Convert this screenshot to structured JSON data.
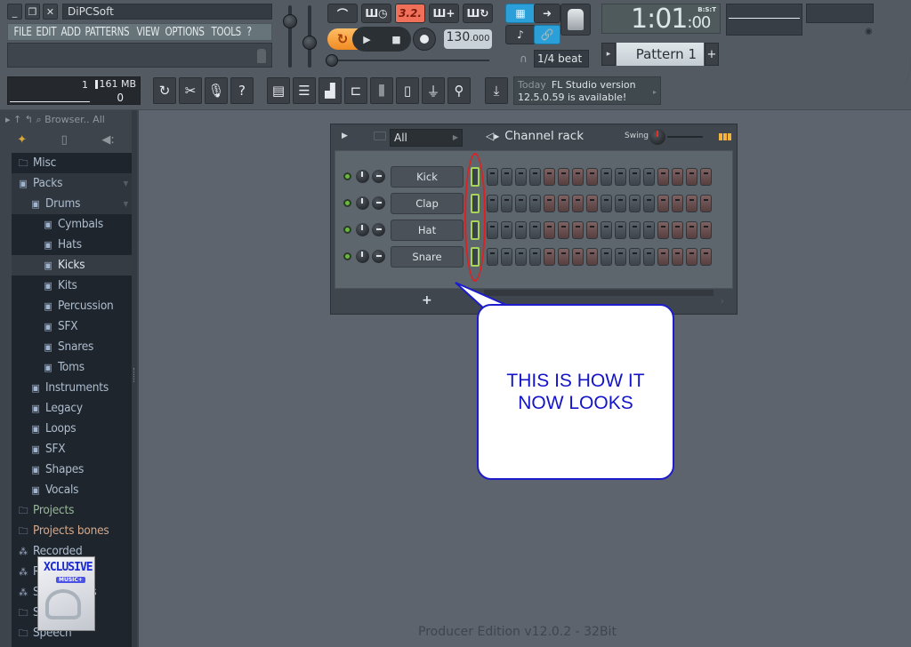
{
  "window": {
    "title": "DiPCSoft",
    "buttons": [
      "minimize",
      "restore",
      "close"
    ],
    "btn_glyphs": [
      "_",
      "❐",
      "✕"
    ]
  },
  "menu": [
    "FILE",
    "EDIT",
    "ADD",
    "PATTERNS",
    "VIEW",
    "OPTIONS",
    "TOOLS",
    "?"
  ],
  "transport": {
    "pattern_song_glyphs": [
      "⌒",
      "Ш◷",
      "3.2.",
      "Ш+",
      "Ш↻"
    ],
    "pattern_song_names": [
      "metronome-button",
      "wait-record-button",
      "countdown-button",
      "step-edit-button",
      "loop-record-button"
    ],
    "loop_glyph": "↻",
    "play_glyph": "▶",
    "stop_glyph": "■",
    "tempo_int": "130",
    "tempo_dec": ".000",
    "snap_label": "1/4 beat",
    "snap_arrow": "▸",
    "magnet_glyph": "∩"
  },
  "view_toggles": {
    "glyphs": [
      "▦",
      "➜",
      "♪",
      "🔗"
    ]
  },
  "time": {
    "main": "1:01",
    "sub": ":00",
    "label": "B:S:T"
  },
  "pattern": {
    "name": "Pattern 1",
    "prev_glyph": "▸",
    "add_glyph": "+"
  },
  "monitor": {
    "cpu": "1",
    "memory": "161 MB",
    "polyphony": "0"
  },
  "tool_buttons": [
    {
      "name": "undo-button",
      "glyph": "↻"
    },
    {
      "name": "cut-button",
      "glyph": "✂"
    },
    {
      "name": "record-audio-button",
      "glyph": "🎙"
    },
    {
      "name": "help-button",
      "glyph": "?"
    }
  ],
  "window_buttons": [
    {
      "name": "playlist-button",
      "glyph": "▤"
    },
    {
      "name": "channel-rack-button",
      "glyph": "☰"
    },
    {
      "name": "piano-roll-button",
      "glyph": "▟"
    },
    {
      "name": "browser-button",
      "glyph": "⊏"
    },
    {
      "name": "mixer-button",
      "glyph": "⫼"
    },
    {
      "name": "project-info-button",
      "glyph": "▯"
    },
    {
      "name": "plugin-button",
      "glyph": "⏚"
    },
    {
      "name": "tempo-tapper-button",
      "glyph": "⚲"
    }
  ],
  "news": {
    "download_glyph": "⤓",
    "today": "Today",
    "line1": "FL Studio version",
    "line2": "12.5.0.59 is available!",
    "arrow": "▸"
  },
  "browser": {
    "header": "Browser.. All",
    "header_glyphs": "▸ ↑ ↰ ⌕",
    "tabs": [
      "✦",
      "▯",
      "◀:"
    ],
    "items": [
      {
        "label": "Misc",
        "icon": "🗀",
        "level": 0,
        "style": "normal"
      },
      {
        "label": "Packs",
        "icon": "▣",
        "level": 0,
        "style": "hl",
        "expanded": true
      },
      {
        "label": "Drums",
        "icon": "▣",
        "level": 1,
        "style": "hl",
        "expanded": true
      },
      {
        "label": "Cymbals",
        "icon": "▣",
        "level": 2,
        "style": "normal"
      },
      {
        "label": "Hats",
        "icon": "▣",
        "level": 2,
        "style": "normal"
      },
      {
        "label": "Kicks",
        "icon": "▣",
        "level": 2,
        "style": "sel"
      },
      {
        "label": "Kits",
        "icon": "▣",
        "level": 2,
        "style": "normal"
      },
      {
        "label": "Percussion",
        "icon": "▣",
        "level": 2,
        "style": "normal"
      },
      {
        "label": "SFX",
        "icon": "▣",
        "level": 2,
        "style": "normal"
      },
      {
        "label": "Snares",
        "icon": "▣",
        "level": 2,
        "style": "normal"
      },
      {
        "label": "Toms",
        "icon": "▣",
        "level": 2,
        "style": "normal"
      },
      {
        "label": "Instruments",
        "icon": "▣",
        "level": 1,
        "style": "normal"
      },
      {
        "label": "Legacy",
        "icon": "▣",
        "level": 1,
        "style": "normal"
      },
      {
        "label": "Loops",
        "icon": "▣",
        "level": 1,
        "style": "normal"
      },
      {
        "label": "SFX",
        "icon": "▣",
        "level": 1,
        "style": "normal"
      },
      {
        "label": "Shapes",
        "icon": "▣",
        "level": 1,
        "style": "normal"
      },
      {
        "label": "Vocals",
        "icon": "▣",
        "level": 1,
        "style": "normal"
      },
      {
        "label": "Projects",
        "icon": "🗀",
        "level": 0,
        "style": "green"
      },
      {
        "label": "Projects bones",
        "icon": "🗀",
        "level": 0,
        "style": "orange"
      },
      {
        "label": "Recorded",
        "icon": "⁂",
        "level": 0,
        "style": "normal"
      },
      {
        "label": "Rendered",
        "icon": "⁂",
        "level": 0,
        "style": "normal"
      },
      {
        "label": "Sliced beats",
        "icon": "⁂",
        "level": 0,
        "style": "normal"
      },
      {
        "label": "Soundfonts",
        "icon": "🗀",
        "level": 0,
        "style": "normal"
      },
      {
        "label": "Speech",
        "icon": "🗀",
        "level": 0,
        "style": "normal"
      }
    ]
  },
  "album_art": {
    "title": "XCLUSIVE",
    "subtitle": "MUSIC+"
  },
  "channel_rack": {
    "title": "Channel rack",
    "filter": "All",
    "swing_label": "Swing",
    "add_glyph": "+",
    "channels": [
      {
        "name": "Kick",
        "steps": [
          0,
          0,
          0,
          0,
          0,
          0,
          0,
          0,
          0,
          0,
          0,
          0,
          0,
          0,
          0,
          0
        ]
      },
      {
        "name": "Clap",
        "steps": [
          0,
          0,
          0,
          0,
          0,
          0,
          0,
          0,
          0,
          0,
          0,
          0,
          0,
          0,
          0,
          0
        ]
      },
      {
        "name": "Hat",
        "steps": [
          0,
          0,
          0,
          0,
          0,
          0,
          0,
          0,
          0,
          0,
          0,
          0,
          0,
          0,
          0,
          0
        ]
      },
      {
        "name": "Snare",
        "steps": [
          0,
          0,
          0,
          0,
          0,
          0,
          0,
          0,
          0,
          0,
          0,
          0,
          0,
          0,
          0,
          0
        ]
      }
    ],
    "step_count": 16
  },
  "annotation": {
    "line1": "THIS IS HOW IT",
    "line2": "NOW LOOKS",
    "text_color": "#1414c8",
    "oval_color": "#e02020"
  },
  "footer": {
    "edition": "Producer Edition v12.0.2 - 32Bit"
  }
}
